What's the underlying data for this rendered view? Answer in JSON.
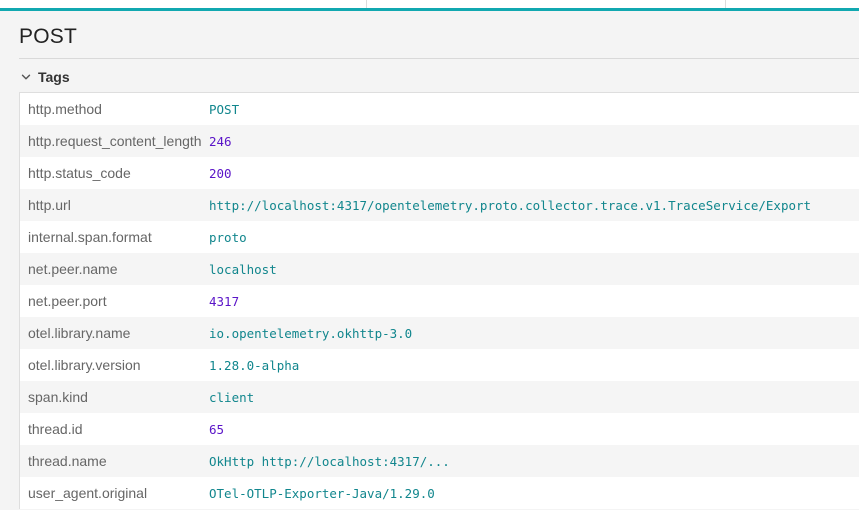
{
  "span": {
    "title": "POST"
  },
  "tags_section": {
    "label": "Tags",
    "expanded": true,
    "rows": [
      {
        "key": "http.method",
        "value": "POST",
        "kind": "string"
      },
      {
        "key": "http.request_content_length",
        "value": "246",
        "kind": "number"
      },
      {
        "key": "http.status_code",
        "value": "200",
        "kind": "number"
      },
      {
        "key": "http.url",
        "value": "http://localhost:4317/opentelemetry.proto.collector.trace.v1.TraceService/Export",
        "kind": "string"
      },
      {
        "key": "internal.span.format",
        "value": "proto",
        "kind": "string"
      },
      {
        "key": "net.peer.name",
        "value": "localhost",
        "kind": "string"
      },
      {
        "key": "net.peer.port",
        "value": "4317",
        "kind": "number"
      },
      {
        "key": "otel.library.name",
        "value": "io.opentelemetry.okhttp-3.0",
        "kind": "string"
      },
      {
        "key": "otel.library.version",
        "value": "1.28.0-alpha",
        "kind": "string"
      },
      {
        "key": "span.kind",
        "value": "client",
        "kind": "string"
      },
      {
        "key": "thread.id",
        "value": "65",
        "kind": "number"
      },
      {
        "key": "thread.name",
        "value": "OkHttp http://localhost:4317/...",
        "kind": "string"
      },
      {
        "key": "user_agent.original",
        "value": "OTel-OTLP-Exporter-Java/1.29.0",
        "kind": "string"
      }
    ]
  },
  "colors": {
    "accent": "#11a8b0",
    "string_value": "#11868d",
    "number_value": "#5a14c8",
    "key_text": "#666666"
  },
  "icons": {
    "section_toggle": "chevron-down-icon"
  }
}
